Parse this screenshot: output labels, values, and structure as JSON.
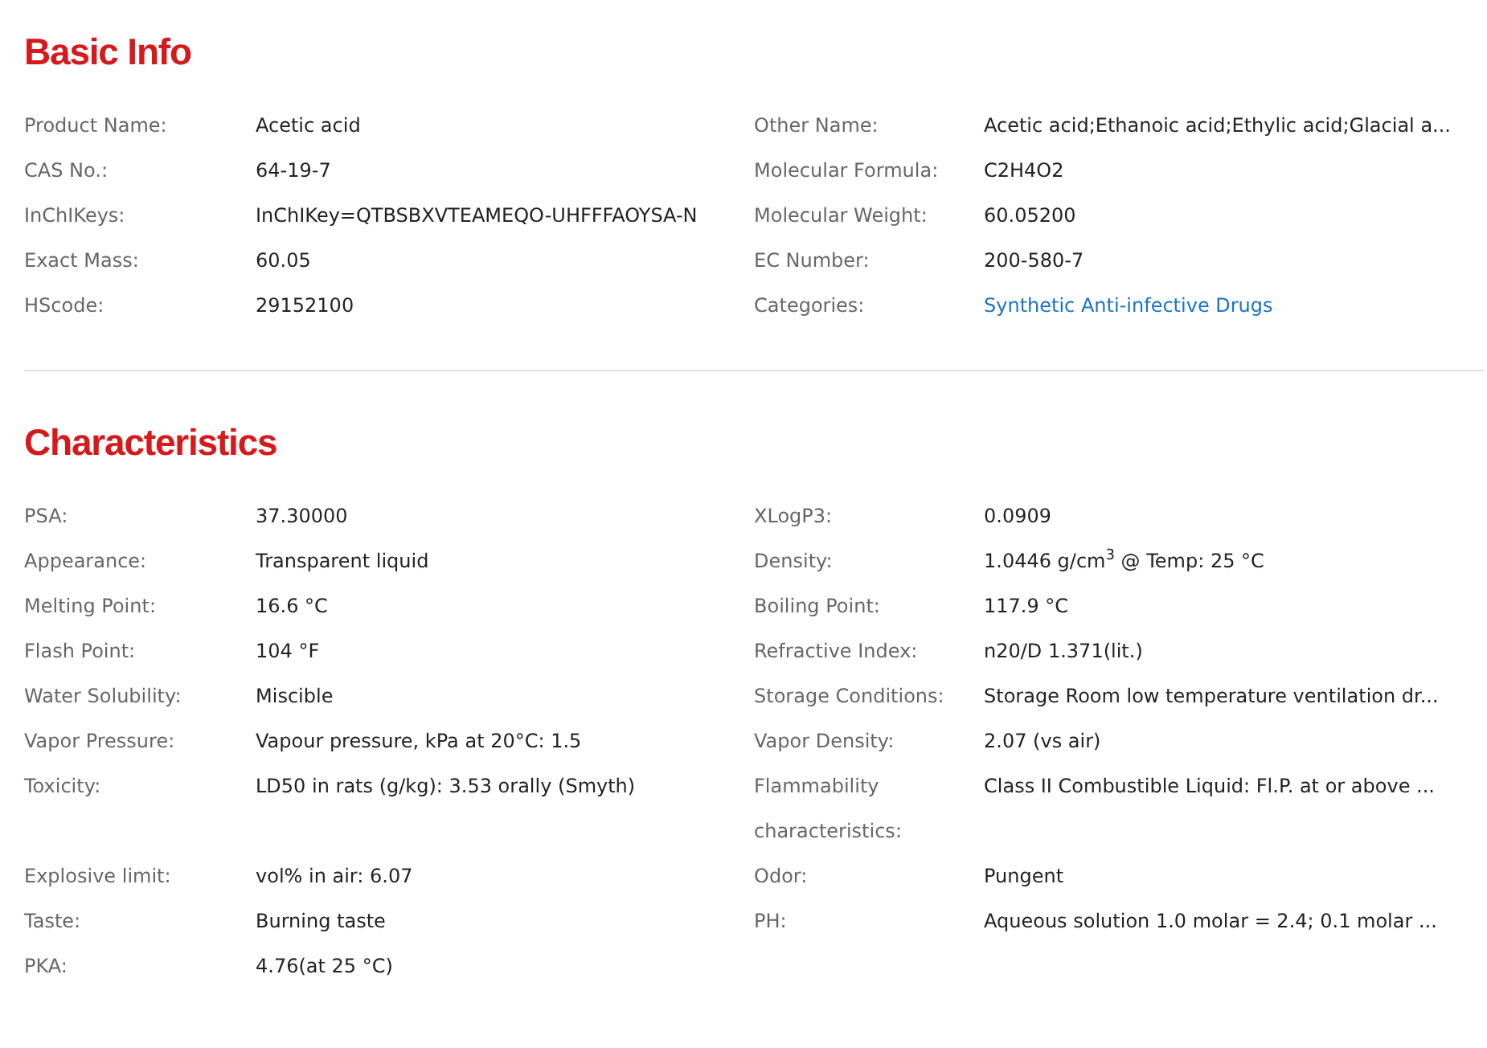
{
  "sections": [
    {
      "title": "Basic Info",
      "rows": [
        {
          "left": {
            "label": "Product Name:",
            "value": "Acetic acid"
          },
          "right": {
            "label": "Other Name:",
            "value": "Acetic acid;Ethanoic acid;Ethylic acid;Glacial a..."
          }
        },
        {
          "left": {
            "label": "CAS No.:",
            "value": "64-19-7"
          },
          "right": {
            "label": "Molecular Formula:",
            "value": "C2H4O2"
          }
        },
        {
          "left": {
            "label": "InChIKeys:",
            "value": "InChIKey=QTBSBXVTEAMEQO-UHFFFAOYSA-N"
          },
          "right": {
            "label": "Molecular Weight:",
            "value": "60.05200"
          }
        },
        {
          "left": {
            "label": "Exact Mass:",
            "value": "60.05"
          },
          "right": {
            "label": "EC Number:",
            "value": "200-580-7"
          }
        },
        {
          "left": {
            "label": "HScode:",
            "value": "29152100"
          },
          "right": {
            "label": "Categories:",
            "value": "Synthetic Anti-infective Drugs",
            "kind": "link"
          }
        }
      ]
    },
    {
      "title": "Characteristics",
      "rows": [
        {
          "left": {
            "label": "PSA:",
            "value": "37.30000"
          },
          "right": {
            "label": "XLogP3:",
            "value": "0.0909"
          }
        },
        {
          "left": {
            "label": "Appearance:",
            "value": "Transparent liquid"
          },
          "right": {
            "label": "Density:",
            "value": "1.0446 g/cm$^{3}$ @ Temp: 25 °C"
          }
        },
        {
          "left": {
            "label": "Melting Point:",
            "value": "16.6 °C"
          },
          "right": {
            "label": "Boiling Point:",
            "value": "117.9 °C"
          }
        },
        {
          "left": {
            "label": "Flash Point:",
            "value": "104 °F"
          },
          "right": {
            "label": "Refractive Index:",
            "value": "n20/D 1.371(lit.)"
          }
        },
        {
          "left": {
            "label": "Water Solubility:",
            "value": "Miscible"
          },
          "right": {
            "label": "Storage Conditions:",
            "value": "Storage Room low temperature ventilation dr..."
          }
        },
        {
          "left": {
            "label": "Vapor Pressure:",
            "value": "Vapour pressure, kPa at 20°C: 1.5"
          },
          "right": {
            "label": "Vapor Density:",
            "value": "2.07 (vs air)"
          }
        },
        {
          "left": {
            "label": "Toxicity:",
            "value": "LD50 in rats (g/kg): 3.53 orally (Smyth)"
          },
          "right": {
            "label": "Flammability characteristics:",
            "value": "Class II Combustible Liquid: Fl.P. at or above ..."
          }
        },
        {
          "left": {
            "label": "Explosive limit:",
            "value": "vol% in air: 6.07"
          },
          "right": {
            "label": "Odor:",
            "value": "Pungent"
          }
        },
        {
          "left": {
            "label": "Taste:",
            "value": "Burning taste"
          },
          "right": {
            "label": "PH:",
            "value": "Aqueous solution 1.0 molar = 2.4; 0.1 molar ..."
          }
        },
        {
          "left": {
            "label": "PKA:",
            "value": "4.76(at 25 °C)"
          }
        }
      ]
    }
  ]
}
